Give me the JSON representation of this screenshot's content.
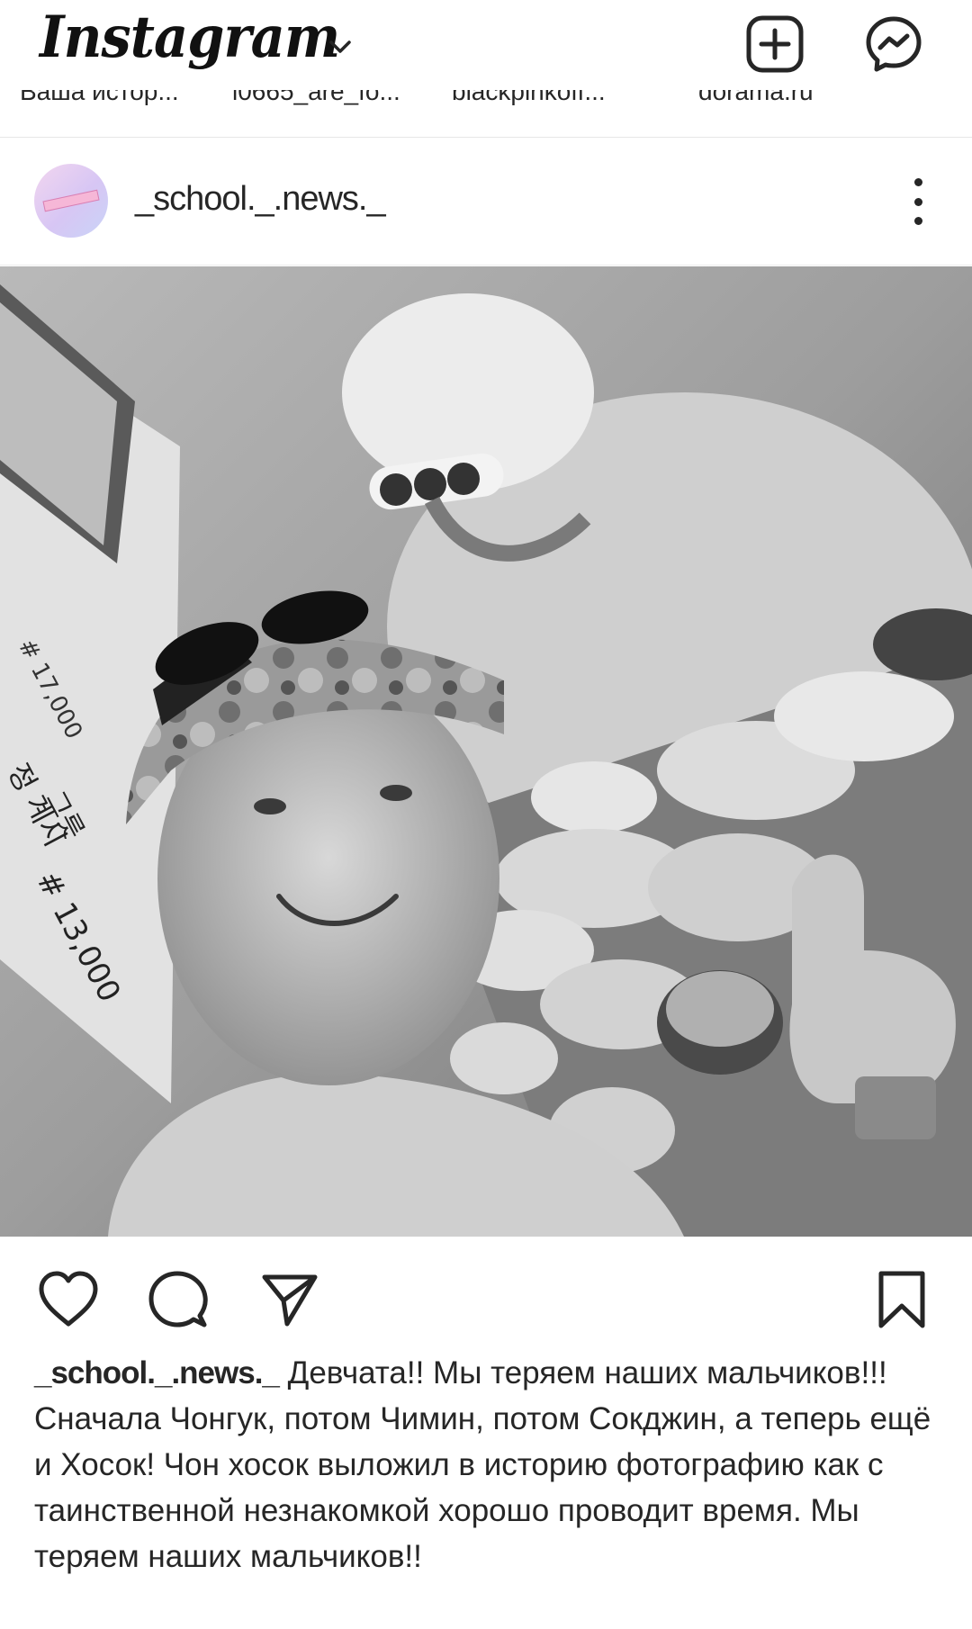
{
  "header": {
    "logo": "Instagram",
    "icons": {
      "chevron": "chevron-down-icon",
      "add": "add-post-icon",
      "messenger": "messenger-icon"
    }
  },
  "stories": [
    "Ваша истор...",
    "i0665_are_fo...",
    "blackpinkоff...",
    "dorama.ru"
  ],
  "post": {
    "username": "_school._.news._",
    "icons": {
      "menu": "more-options-icon",
      "like": "heart-icon",
      "comment": "comment-icon",
      "share": "share-icon",
      "save": "bookmark-icon"
    },
    "photo": {
      "alt": "selfie photo",
      "sign_texts": [
        "# 17,000",
        "정 계시",
        "그릇",
        "# 13,000"
      ]
    },
    "caption_username": "_school._.news._",
    "caption_text": "Девчата!! Мы теряем наших мальчиков!!! Сначала Чонгук, потом Чимин, потом Сокджин, а теперь ещё и Хосок! Чон хосок выложил в историю фотографию как с таинственной незнакомкой хорошо проводит время. Мы теряем наших мальчиков!!"
  },
  "colors": {
    "text": "#262626",
    "background": "#ffffff",
    "avatar_gradient": "#d7c6f4"
  }
}
